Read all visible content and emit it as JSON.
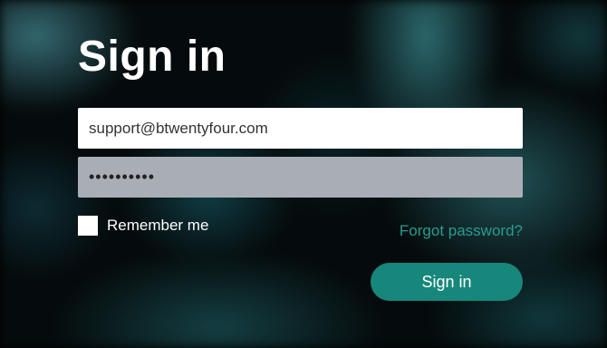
{
  "page": {
    "title": "Sign in"
  },
  "form": {
    "email_value": "support@btwentyfour.com",
    "password_value": "••••••••••",
    "remember_label": "Remember me",
    "remember_checked": false,
    "forgot_label": "Forgot password?",
    "submit_label": "Sign in"
  },
  "colors": {
    "accent": "#16877a",
    "link": "#2a9c8e",
    "password_bg": "#a9aeb6"
  }
}
